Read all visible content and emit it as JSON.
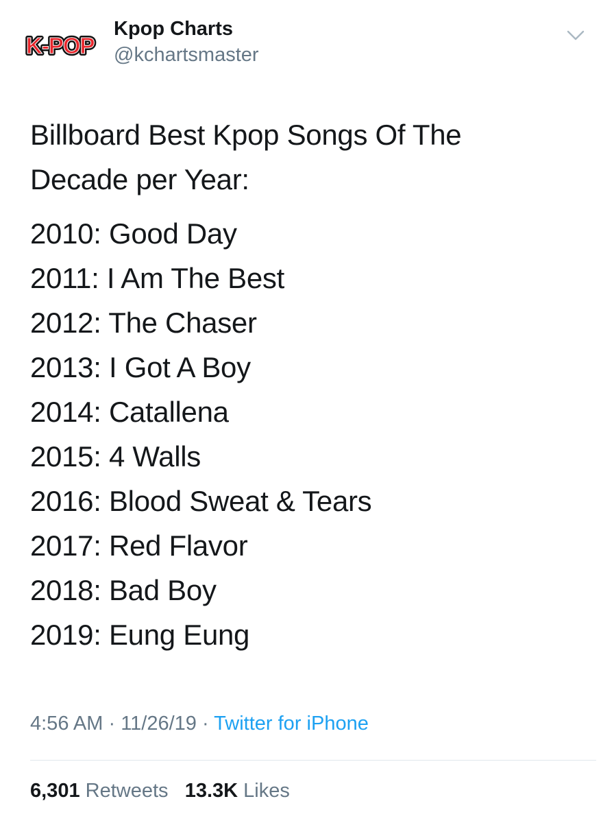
{
  "author": {
    "avatar_logo_text": "K-POP",
    "display_name": "Kpop Charts",
    "handle": "@kchartsmaster"
  },
  "tweet": {
    "intro_lines": [
      "Billboard Best Kpop Songs Of The",
      "Decade per Year:"
    ],
    "entries": [
      "2010: Good Day",
      "2011: I Am The Best",
      "2012: The Chaser",
      "2013: I Got A Boy",
      "2014: Catallena",
      "2015: 4 Walls",
      "2016: Blood Sweat & Tears",
      "2017: Red Flavor",
      "2018: Bad Boy",
      "2019: Eung Eung"
    ]
  },
  "meta": {
    "time": "4:56 AM",
    "separator": " · ",
    "date": "11/26/19",
    "source": "Twitter for iPhone"
  },
  "stats": {
    "retweets_count": "6,301",
    "retweets_label": "Retweets",
    "likes_count": "13.3K",
    "likes_label": "Likes"
  },
  "icons": {
    "menu": "chevron-down-icon",
    "avatar": "kpop-logo"
  },
  "colors": {
    "text": "#14171a",
    "secondary": "#657786",
    "link": "#1da1f2",
    "logo_red": "#e8262c"
  }
}
